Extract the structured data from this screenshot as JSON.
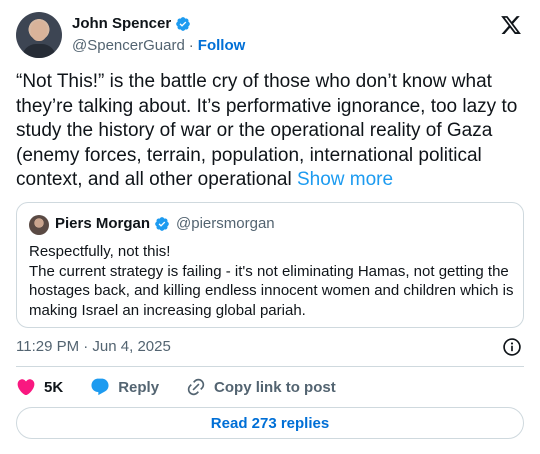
{
  "author": {
    "name": "John Spencer",
    "handle": "@SpencerGuard",
    "separator": "·",
    "follow_label": "Follow"
  },
  "tweet": {
    "text": "“Not This!” is the battle cry of those who don’t know what they’re talking about. It’s performative ignorance, too lazy to study the history of war or the operational reality of Gaza (enemy forces, terrain, population, international political context, and all other operational ",
    "show_more": "Show more"
  },
  "quote": {
    "name": "Piers Morgan",
    "handle": "@piersmorgan",
    "line1": "Respectfully, not this!",
    "line2": "The current strategy is failing - it's not eliminating Hamas, not getting the hostages back, and killing endless innocent women and children which is making Israel an increasing global pariah."
  },
  "timestamp": "11:29 PM · Jun 4, 2025",
  "actions": {
    "like_count": "5K",
    "reply_label": "Reply",
    "copy_label": "Copy link to post"
  },
  "read_replies_label": "Read 273 replies",
  "colors": {
    "accent": "#1d9bf0",
    "link": "#006fd6",
    "like": "#f91880",
    "secondary_text": "#536471"
  },
  "icons": [
    "verified-badge-icon",
    "x-logo-icon",
    "info-icon",
    "heart-icon",
    "reply-bubble-icon",
    "link-icon"
  ]
}
